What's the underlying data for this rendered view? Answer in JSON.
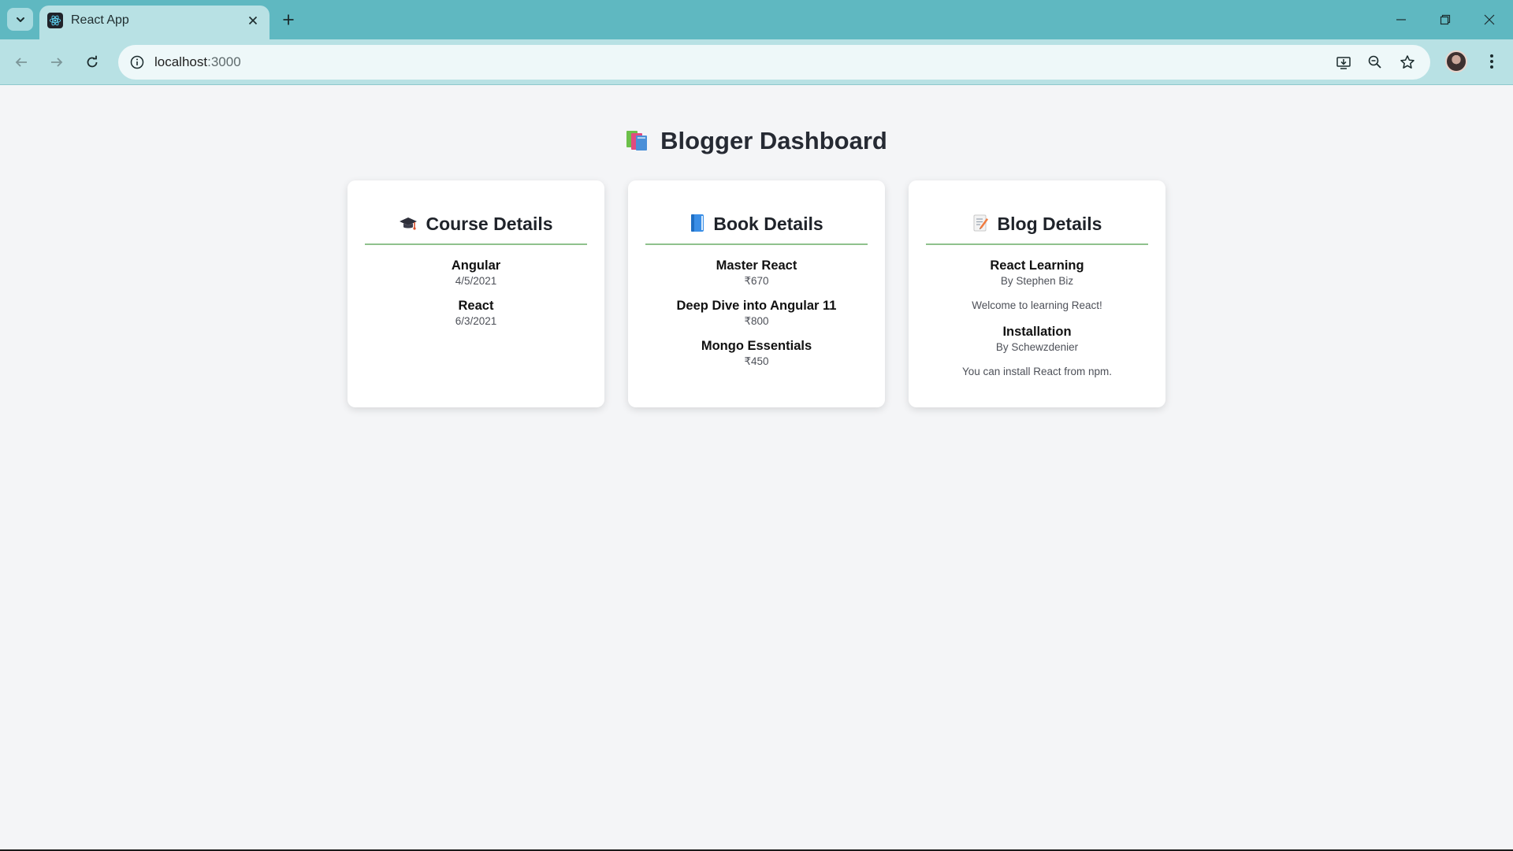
{
  "browser": {
    "tab_title": "React App",
    "url_host": "localhost",
    "url_port": ":3000"
  },
  "page": {
    "title": "Blogger Dashboard"
  },
  "courses": {
    "heading": "Course Details",
    "items": [
      {
        "name": "Angular",
        "date": "4/5/2021"
      },
      {
        "name": "React",
        "date": "6/3/2021"
      }
    ]
  },
  "books": {
    "heading": "Book Details",
    "items": [
      {
        "name": "Master React",
        "price": "₹670"
      },
      {
        "name": "Deep Dive into Angular 11",
        "price": "₹800"
      },
      {
        "name": "Mongo Essentials",
        "price": "₹450"
      }
    ]
  },
  "blogs": {
    "heading": "Blog Details",
    "items": [
      {
        "title": "React Learning",
        "author": "By Stephen Biz",
        "content": "Welcome to learning React!"
      },
      {
        "title": "Installation",
        "author": "By Schewzdenier",
        "content": "You can install React from npm."
      }
    ]
  },
  "colors": {
    "titlebar": "#5fb8c1",
    "toolbar": "#b8e1e4",
    "page_bg": "#f4f5f7",
    "card_rule": "#8fc18d"
  },
  "icons": {
    "page_title": "books-icon",
    "courses": "graduation-cap-icon",
    "books": "blue-book-icon",
    "blogs": "memo-icon"
  }
}
